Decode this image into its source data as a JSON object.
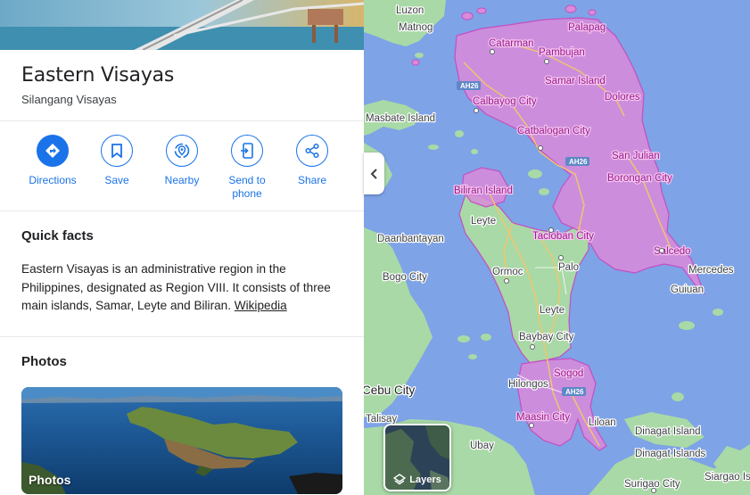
{
  "place": {
    "title": "Eastern Visayas",
    "subtitle": "Silangang Visayas"
  },
  "actions": [
    {
      "label": "Directions",
      "icon": "directions-icon"
    },
    {
      "label": "Save",
      "icon": "bookmark-icon"
    },
    {
      "label": "Nearby",
      "icon": "nearby-icon"
    },
    {
      "label": "Send to phone",
      "icon": "send-to-phone-icon"
    },
    {
      "label": "Share",
      "icon": "share-icon"
    }
  ],
  "quick_facts": {
    "heading": "Quick facts",
    "body": "Eastern Visayas is an administrative region in the Philippines, designated as Region VIII. It consists of three main islands, Samar, Leyte and Biliran.",
    "link": "Wikipedia"
  },
  "photos": {
    "heading": "Photos",
    "card_label": "Photos"
  },
  "map": {
    "layers_label": "Layers",
    "road_shield": "AH26",
    "labels": [
      "Luzon",
      "Matnog",
      "Palapag",
      "Catarman",
      "Pambujan",
      "Samar Island",
      "Dolores",
      "Calbayog City",
      "Masbate Island",
      "Catbalogan City",
      "San Julian",
      "Borongan City",
      "Biliran Island",
      "Leyte",
      "Daanbantayan",
      "Tacloban City",
      "Salcedo",
      "Palo",
      "Ormoc",
      "Bogo City",
      "Mercedes",
      "Guiuan",
      "Leyte",
      "Baybay City",
      "Sogod",
      "Hilongos",
      "Cebu City",
      "Maasin City",
      "Liloan",
      "Talisay",
      "Ubay",
      "Dinagat Island",
      "Dinagat Islands",
      "Surigao City",
      "Siargao Is"
    ]
  },
  "colors": {
    "accent": "#1a73e8",
    "water": "#7ea3e7",
    "land": "#a9d9a6",
    "region_fill": "#d98bd9",
    "region_border": "#c44fc2"
  }
}
